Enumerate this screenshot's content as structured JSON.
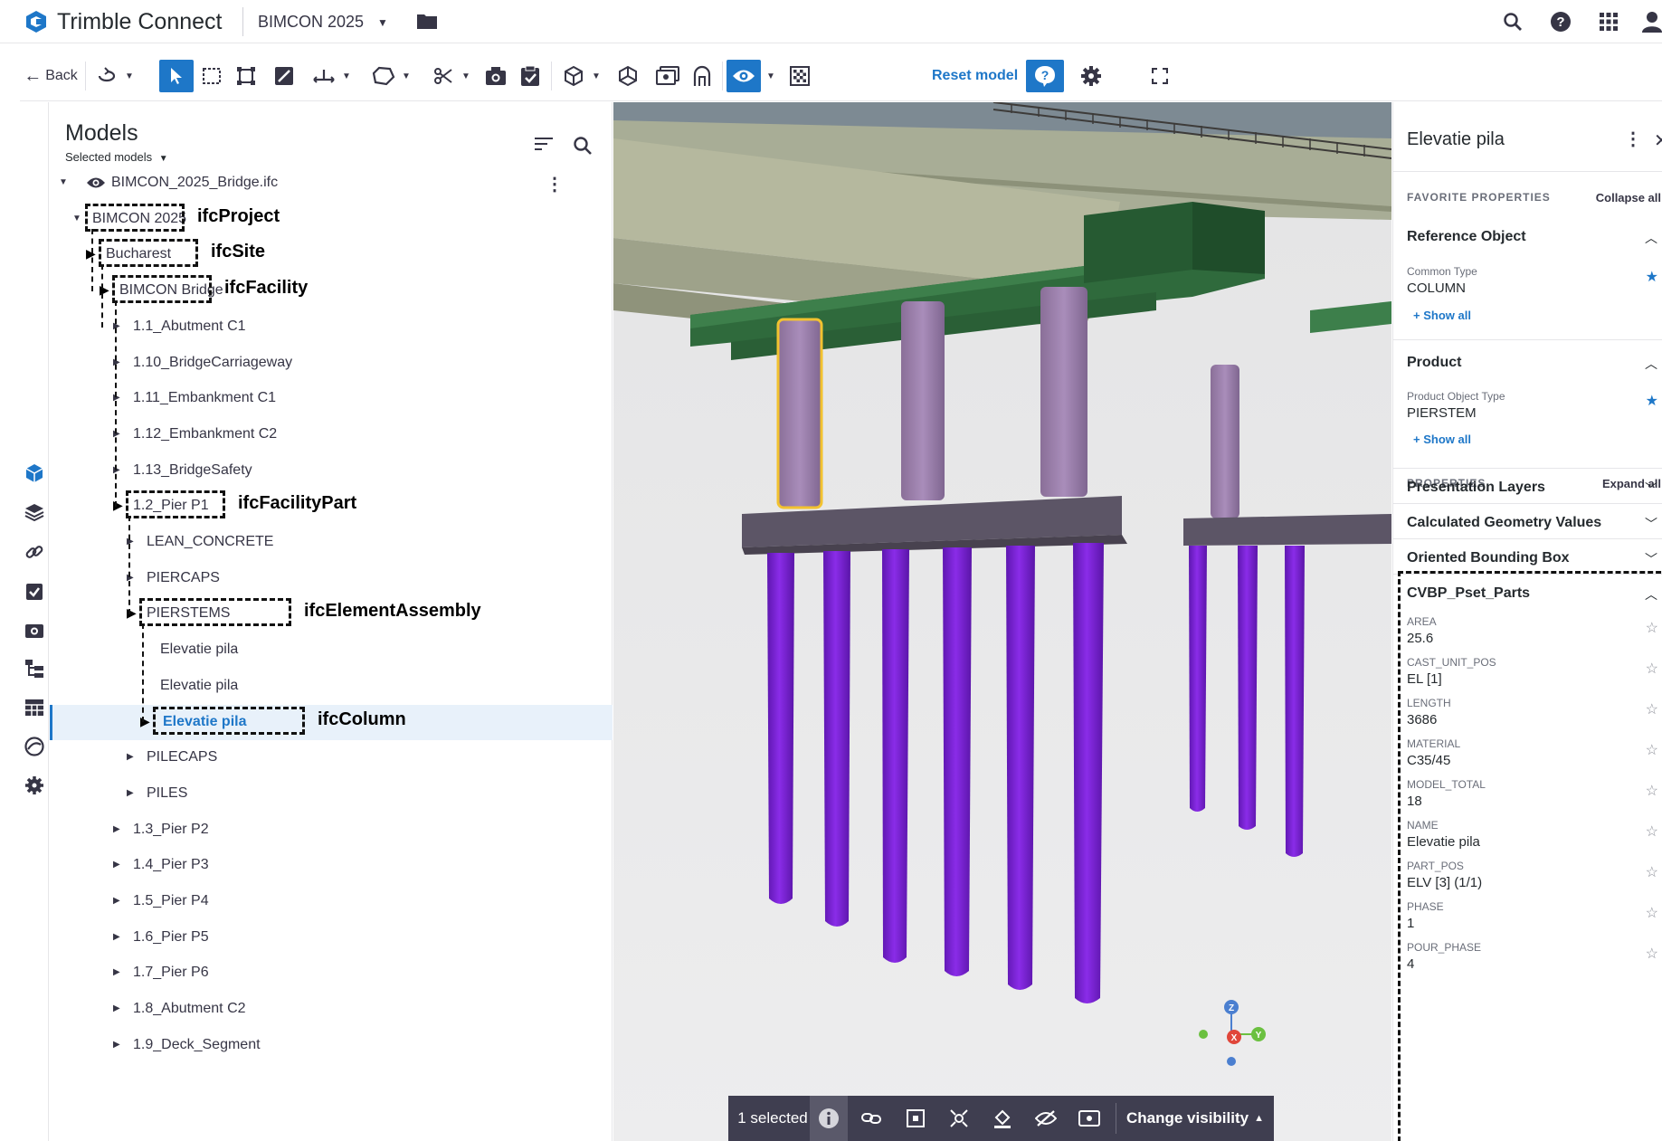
{
  "topbar": {
    "app_title": "Trimble Connect",
    "project_name": "BIMCON 2025"
  },
  "toolbar": {
    "back_label": "Back",
    "reset_model_label": "Reset model"
  },
  "models_panel": {
    "title": "Models",
    "selected_models": "Selected models",
    "tree": [
      {
        "label": "BIMCON_2025_Bridge.ifc"
      },
      {
        "label": "BIMCON 2025",
        "ifc": "ifcProject"
      },
      {
        "label": "Bucharest",
        "ifc": "ifcSite"
      },
      {
        "label": "BIMCON Bridge",
        "ifc": "ifcFacility"
      },
      {
        "label": "1.1_Abutment C1"
      },
      {
        "label": "1.10_BridgeCarriageway"
      },
      {
        "label": "1.11_Embankment C1"
      },
      {
        "label": "1.12_Embankment C2"
      },
      {
        "label": "1.13_BridgeSafety"
      },
      {
        "label": "1.2_Pier P1",
        "ifc": "ifcFacilityPart"
      },
      {
        "label": "LEAN_CONCRETE"
      },
      {
        "label": "PIERCAPS"
      },
      {
        "label": "PIERSTEMS",
        "ifc": "ifcElementAssembly"
      },
      {
        "label": "Elevatie pila"
      },
      {
        "label": "Elevatie pila"
      },
      {
        "label": "Elevatie pila",
        "ifc": "ifcColumn"
      },
      {
        "label": "PILECAPS"
      },
      {
        "label": "PILES"
      },
      {
        "label": "1.3_Pier P2"
      },
      {
        "label": "1.4_Pier P3"
      },
      {
        "label": "1.5_Pier P4"
      },
      {
        "label": "1.6_Pier P5"
      },
      {
        "label": "1.7_Pier P6"
      },
      {
        "label": "1.8_Abutment C2"
      },
      {
        "label": "1.9_Deck_Segment"
      }
    ]
  },
  "bottom_bar": {
    "selected_count": "1 selected",
    "change_visibility": "Change visibility"
  },
  "properties": {
    "title": "Elevatie pila",
    "favorite_header": "FAVORITE PROPERTIES",
    "collapse_all": "Collapse all",
    "properties_header": "PROPERTIES",
    "expand_all": "Expand all",
    "show_all": "Show all",
    "ref_group": "Reference Object",
    "ref_key": "Common Type",
    "ref_val": "COLUMN",
    "product_group": "Product",
    "product_key": "Product Object Type",
    "product_val": "PIERSTEM",
    "groups": [
      "Presentation Layers",
      "Calculated Geometry Values",
      "Oriented Bounding Box",
      "CVBP_Pset_Parts"
    ],
    "pset": [
      {
        "k": "AREA",
        "v": "25.6"
      },
      {
        "k": "CAST_UNIT_POS",
        "v": "EL [1]"
      },
      {
        "k": "LENGTH",
        "v": "3686"
      },
      {
        "k": "MATERIAL",
        "v": "C35/45"
      },
      {
        "k": "MODEL_TOTAL",
        "v": "18"
      },
      {
        "k": "NAME",
        "v": "Elevatie pila"
      },
      {
        "k": "PART_POS",
        "v": "ELV [3] (1/1)"
      },
      {
        "k": "PHASE",
        "v": "1"
      },
      {
        "k": "POUR_PHASE",
        "v": "4"
      }
    ]
  },
  "colors": {
    "accent": "#1e77c8",
    "pier_stem": "#9b7fa8",
    "pile": "#7a1fd6",
    "pier_cap": "#5c5566",
    "deck_green": "#2f6a3c"
  }
}
